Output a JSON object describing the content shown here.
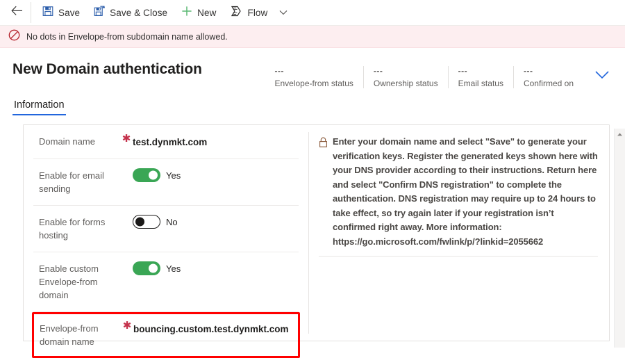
{
  "commandbar": {
    "back_icon": "back-arrow-icon",
    "buttons": [
      {
        "label": "Save",
        "icon": "save-disk-icon"
      },
      {
        "label": "Save & Close",
        "icon": "save-and-close-icon"
      },
      {
        "label": "New",
        "icon": "plus-icon"
      },
      {
        "label": "Flow",
        "icon": "flow-icon"
      }
    ],
    "overflow_icon": "chevron-down-icon"
  },
  "error_banner": {
    "icon": "block-error-icon",
    "message": "No dots in Envelope-from subdomain name allowed."
  },
  "header": {
    "title": "New Domain authentication",
    "statuses": [
      {
        "value": "---",
        "label": "Envelope-from status"
      },
      {
        "value": "---",
        "label": "Ownership status"
      },
      {
        "value": "---",
        "label": "Email status"
      },
      {
        "value": "---",
        "label": "Confirmed on"
      }
    ],
    "expand_icon": "chevron-down-icon"
  },
  "tabs": [
    {
      "label": "Information",
      "active": true
    }
  ],
  "form": {
    "fields": [
      {
        "label": "Domain name",
        "required": true,
        "type": "text",
        "value": "test.dynmkt.com",
        "highlighted": false
      },
      {
        "label": "Enable for email sending",
        "required": false,
        "type": "toggle",
        "state": "on",
        "value": "Yes",
        "highlighted": false
      },
      {
        "label": "Enable for forms hosting",
        "required": false,
        "type": "toggle",
        "state": "off",
        "value": "No",
        "highlighted": false
      },
      {
        "label": "Enable custom Envelope-from domain",
        "required": false,
        "type": "toggle",
        "state": "on",
        "value": "Yes",
        "highlighted": false
      },
      {
        "label": "Envelope-from domain name",
        "required": true,
        "type": "text",
        "value": "bouncing.custom.test.dynmkt.com",
        "highlighted": true
      }
    ]
  },
  "info_panel": {
    "icon": "lock-icon",
    "text": "Enter your domain name and select \"Save\" to generate your verification keys. Register the generated keys shown here with your DNS provider according to their instructions. Return here and select \"Confirm DNS registration\" to complete the authentication. DNS registration may require up to 24 hours to take effect, so try again later if your registration isn’t confirmed right away. More information: https://go.microsoft.com/fwlink/p/?linkid=2055662"
  },
  "scrollbar": {
    "up_icon": "scroll-up-arrow-icon"
  },
  "colors": {
    "accent": "#2266dd",
    "toggle_on": "#3aa655",
    "error_bg": "#fdeef0",
    "required_star": "#c4314b",
    "highlight_box": "#ff0000"
  }
}
